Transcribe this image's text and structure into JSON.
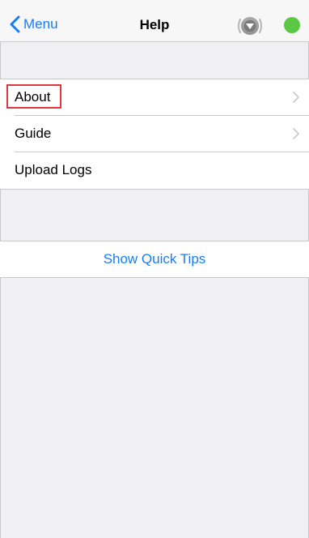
{
  "nav": {
    "back_label": "Menu",
    "title": "Help",
    "device_icon": "speaker-device-icon",
    "status_color": "#5ac843"
  },
  "help_items": [
    {
      "label": "About",
      "icon": "chevron-right-icon",
      "highlighted": true
    },
    {
      "label": "Guide",
      "icon": "chevron-right-icon"
    },
    {
      "label": "Upload Logs"
    }
  ],
  "actions": {
    "quick_tips_label": "Show Quick Tips"
  },
  "colors": {
    "accent": "#1a7cf5",
    "background": "#efeff4",
    "highlight_border": "#e0373c"
  }
}
